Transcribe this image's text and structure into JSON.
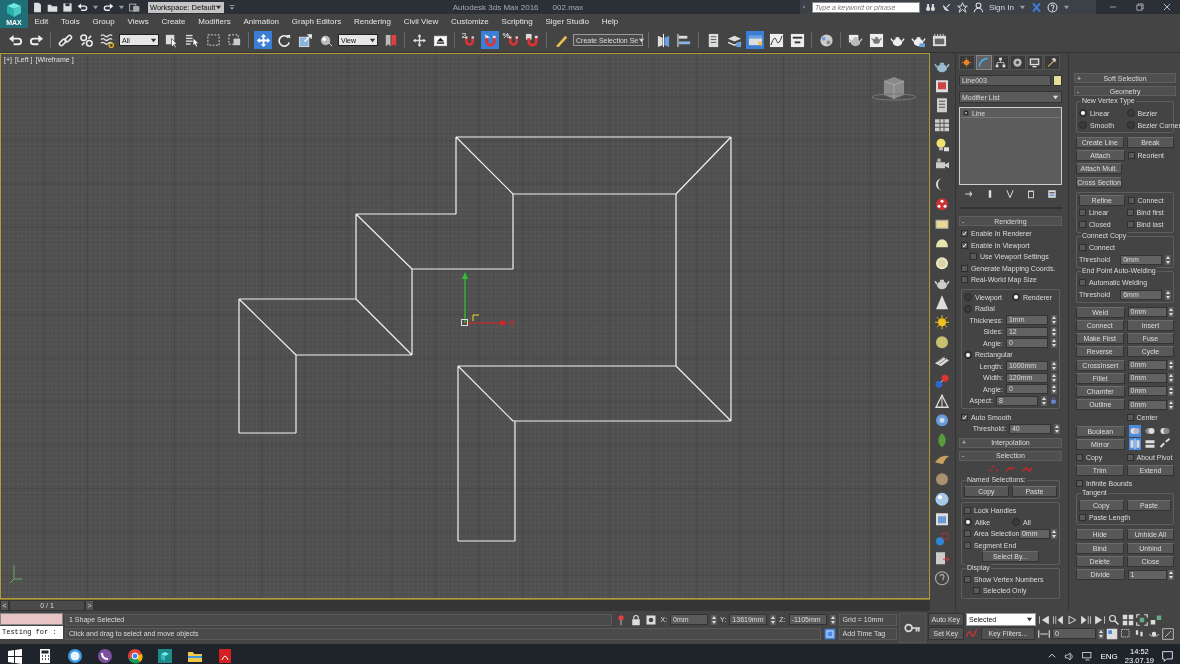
{
  "header": {
    "logo_text": "MAX",
    "workspace": "Workspace: Default",
    "title": "Autodesk 3ds Max 2016",
    "file": "002.max",
    "search_placeholder": "Type a keyword or phrase",
    "sign_in": "Sign In"
  },
  "menu": [
    "Edit",
    "Tools",
    "Group",
    "Views",
    "Create",
    "Modifiers",
    "Animation",
    "Graph Editors",
    "Rendering",
    "Civil View",
    "Customize",
    "Scripting",
    "Siger Studio",
    "Help"
  ],
  "toolbar": {
    "selection_filter": "All",
    "reference_coordinate": "View",
    "named_selection": "Create Selection Se",
    "buttons": [
      {
        "selected": false
      },
      {
        "selected": false
      },
      {
        "selected": false
      },
      {
        "selected": false
      },
      {
        "selected": false
      },
      {
        "selected": false
      },
      {
        "selected": false
      },
      {
        "selected": false
      },
      {
        "selected": false
      },
      {
        "selected": true
      },
      {
        "selected": false
      },
      {
        "selected": false
      },
      {
        "selected": false
      },
      {
        "selected": false
      },
      {
        "selected": false
      },
      {
        "selected": false
      },
      {
        "selected": false,
        "label": "2"
      },
      {
        "selected": true
      },
      {
        "selected": false,
        "label": "%"
      },
      {
        "selected": false
      },
      {
        "selected": false
      },
      {
        "selected": false
      },
      {
        "selected": false
      },
      {
        "selected": false
      },
      {
        "selected": false
      },
      {
        "selected": true
      },
      {
        "selected": false
      },
      {
        "selected": false
      },
      {
        "selected": false
      },
      {
        "selected": false
      },
      {
        "selected": false
      },
      {
        "selected": false
      },
      {
        "selected": false
      },
      {
        "selected": false
      }
    ]
  },
  "viewport": {
    "labels": [
      "[+]",
      "[Left ]",
      "[Wireframe ]"
    ],
    "gizmo_label": "x"
  },
  "timeline": {
    "prev": "<",
    "frame": "0 / 1",
    "next": ">"
  },
  "command_panel": {
    "tabs": [
      {
        "selected": false
      },
      {
        "selected": true
      },
      {
        "selected": false
      },
      {
        "selected": false
      },
      {
        "selected": false
      },
      {
        "selected": false
      }
    ],
    "object_name": "Line003",
    "modifier_list": "Modifier List",
    "stack": [
      {
        "label": "Line",
        "selected": false
      }
    ],
    "left_rollouts": [
      {
        "sign": "-",
        "title": "Rendering",
        "rows": [
          {
            "kind": "check",
            "label": "Enable In Renderer",
            "checked": true
          },
          {
            "kind": "check",
            "label": "Enable In Viewport",
            "checked": true,
            "children": [
              {
                "label": "Use Viewport Settings",
                "checked": false
              }
            ]
          },
          {
            "kind": "check",
            "label": "Generate Mapping Coords.",
            "checked": false
          },
          {
            "kind": "check",
            "label": "Real-World Map Size",
            "checked": false
          },
          {
            "kind": "group",
            "rows": [
              {
                "kind": "radio_pair",
                "items": [
                  {
                    "label": "Viewport",
                    "selected": false
                  },
                  {
                    "label": "Renderer",
                    "selected": true
                  }
                ]
              },
              {
                "kind": "radio",
                "label": "Radial",
                "selected": false
              },
              {
                "kind": "spinner",
                "label": "Thickness:",
                "value": "1mm"
              },
              {
                "kind": "spinner",
                "label": "Sides:",
                "value": "12"
              },
              {
                "kind": "spinner",
                "label": "Angle:",
                "value": "0"
              },
              {
                "kind": "radio",
                "label": "Rectangular",
                "selected": true
              },
              {
                "kind": "spinner",
                "label": "Length:",
                "value": "1000mm"
              },
              {
                "kind": "spinner",
                "label": "Width:",
                "value": "120mm"
              },
              {
                "kind": "spinner",
                "label": "Angle:",
                "value": "0"
              },
              {
                "kind": "spinner_lock",
                "label": "Aspect:",
                "value": "8"
              }
            ]
          },
          {
            "kind": "check",
            "label": "Auto Smooth",
            "checked": true
          },
          {
            "kind": "spinner",
            "label": "Threshold:",
            "value": "40"
          }
        ]
      },
      {
        "sign": "+",
        "title": "Interpolation"
      },
      {
        "sign": "-",
        "title": "Selection",
        "rows": [
          {
            "kind": "levels",
            "items": [
              {
                "selected": false
              },
              {
                "selected": false
              },
              {
                "selected": false
              }
            ]
          },
          {
            "kind": "group",
            "title": "Named Selections:",
            "rows": [
              {
                "kind": "button_pair",
                "items": [
                  "Copy",
                  "Paste"
                ]
              }
            ]
          },
          {
            "kind": "group",
            "rows": [
              {
                "kind": "check",
                "label": "Lock Handles",
                "checked": false
              },
              {
                "kind": "radio_pair",
                "items": [
                  {
                    "label": "Alike",
                    "selected": true
                  },
                  {
                    "label": "All",
                    "selected": false
                  }
                ]
              },
              {
                "kind": "check_spinner",
                "label": "Area Selection:",
                "checked": false,
                "value": "0mm"
              },
              {
                "kind": "check",
                "label": "Segment End",
                "checked": false
              },
              {
                "kind": "button",
                "label": "Select By..."
              }
            ]
          },
          {
            "kind": "group",
            "title": "Display",
            "rows": [
              {
                "kind": "check",
                "label": "Show Vertex Numbers",
                "checked": false,
                "children": [
                  {
                    "label": "Selected Only",
                    "checked": false
                  }
                ]
              }
            ]
          }
        ]
      }
    ],
    "right_rollouts": [
      {
        "sign": "+",
        "title": "Soft Selection"
      },
      {
        "sign": "-",
        "title": "Geometry",
        "rows": [
          {
            "kind": "group",
            "title": "New Vertex Type",
            "rows": [
              {
                "kind": "radio_pair",
                "items": [
                  {
                    "label": "Linear",
                    "selected": true
                  },
                  {
                    "label": "Bezier",
                    "selected": false
                  }
                ]
              },
              {
                "kind": "radio_pair",
                "items": [
                  {
                    "label": "Smooth",
                    "selected": false
                  },
                  {
                    "label": "Bezier Corner",
                    "selected": false
                  }
                ]
              }
            ]
          },
          {
            "kind": "button_pair",
            "items": [
              "Create Line",
              "Break"
            ]
          },
          {
            "kind": "button_check",
            "label": "Attach",
            "check": {
              "label": "Reorient",
              "checked": false
            }
          },
          {
            "kind": "button",
            "label": "Attach Mult."
          },
          {
            "kind": "button",
            "label": "Cross Section"
          },
          {
            "kind": "group",
            "rows": [
              {
                "kind": "button_check",
                "label": "Refine",
                "check": {
                  "label": "Connect",
                  "checked": false
                }
              },
              {
                "kind": "check_pair",
                "items": [
                  {
                    "label": "Linear",
                    "checked": false
                  },
                  {
                    "label": "Bind first",
                    "checked": false
                  }
                ]
              },
              {
                "kind": "check_pair",
                "items": [
                  {
                    "label": "Closed",
                    "checked": false
                  },
                  {
                    "label": "Bind last",
                    "checked": false
                  }
                ]
              }
            ]
          },
          {
            "kind": "group",
            "title": "Connect Copy",
            "rows": [
              {
                "kind": "check",
                "label": "Connect",
                "checked": false
              },
              {
                "kind": "spinner",
                "label": "Threshold",
                "value": "0mm"
              }
            ]
          },
          {
            "kind": "group",
            "title": "End Point Auto-Welding",
            "rows": [
              {
                "kind": "check",
                "label": "Automatic Welding",
                "checked": false
              },
              {
                "kind": "spinner",
                "label": "Threshold",
                "value": "6mm"
              }
            ]
          },
          {
            "kind": "button_spinner",
            "label": "Weld",
            "value": "0mm"
          },
          {
            "kind": "button_pair",
            "items": [
              "Connect",
              "Insert"
            ]
          },
          {
            "kind": "button_pair",
            "items": [
              "Make First",
              "Fuse"
            ]
          },
          {
            "kind": "button_pair",
            "items": [
              "Reverse",
              "Cycle"
            ]
          },
          {
            "kind": "button_spinner",
            "label": "CrossInsert",
            "value": "0mm"
          },
          {
            "kind": "button_spinner",
            "label": "Fillet",
            "value": "0mm"
          },
          {
            "kind": "button_spinner",
            "label": "Chamfer",
            "value": "0mm"
          },
          {
            "kind": "button_spinner",
            "label": "Outline",
            "value": "0mm"
          },
          {
            "kind": "check_end",
            "label": "Center",
            "checked": false
          },
          {
            "kind": "boolean_row",
            "label": "Boolean",
            "icons": [
              {
                "selected": true
              },
              {
                "selected": false
              },
              {
                "selected": false
              }
            ]
          },
          {
            "kind": "mirror_row",
            "label": "Mirror",
            "icons": [
              {
                "selected": true
              },
              {
                "selected": false
              },
              {
                "selected": false
              }
            ]
          },
          {
            "kind": "check_pair",
            "items": [
              {
                "label": "Copy",
                "checked": false
              },
              {
                "label": "About Pivot",
                "checked": false
              }
            ]
          },
          {
            "kind": "button_pair",
            "items": [
              "Trim",
              "Extend"
            ]
          },
          {
            "kind": "check",
            "label": "Infinite Bounds",
            "checked": false
          },
          {
            "kind": "group",
            "title": "Tangent",
            "rows": [
              {
                "kind": "button_pair",
                "items": [
                  "Copy",
                  "Paste"
                ]
              },
              {
                "kind": "check",
                "label": "Paste Length",
                "checked": false
              }
            ]
          },
          {
            "kind": "button_pair",
            "items": [
              "Hide",
              "Unhide All"
            ]
          },
          {
            "kind": "button_pair",
            "items": [
              "Bind",
              "Unbind"
            ]
          },
          {
            "kind": "button_pair",
            "items": [
              "Delete",
              "Close"
            ]
          },
          {
            "kind": "button_spinner",
            "label": "Divide",
            "value": "1"
          }
        ]
      }
    ]
  },
  "status": {
    "script_input": "Testing for :",
    "selection": "1 Shape Selected",
    "prompt": "Click and drag to select and move objects",
    "coords": [
      {
        "label": "X:",
        "value": "0mm"
      },
      {
        "label": "Y:",
        "value": "13619mm"
      },
      {
        "label": "Z:",
        "value": "-1105mm"
      }
    ],
    "grid": "Grid = 10mm",
    "time_tag": "Add Time Tag",
    "auto_key": "Auto Key",
    "key_mode": "Selected",
    "set_key": "Set Key",
    "key_filters": "Key Filters...",
    "frame": "0"
  },
  "taskbar": {
    "language": "ENG",
    "time": "14:52",
    "date": "23.07.19"
  }
}
